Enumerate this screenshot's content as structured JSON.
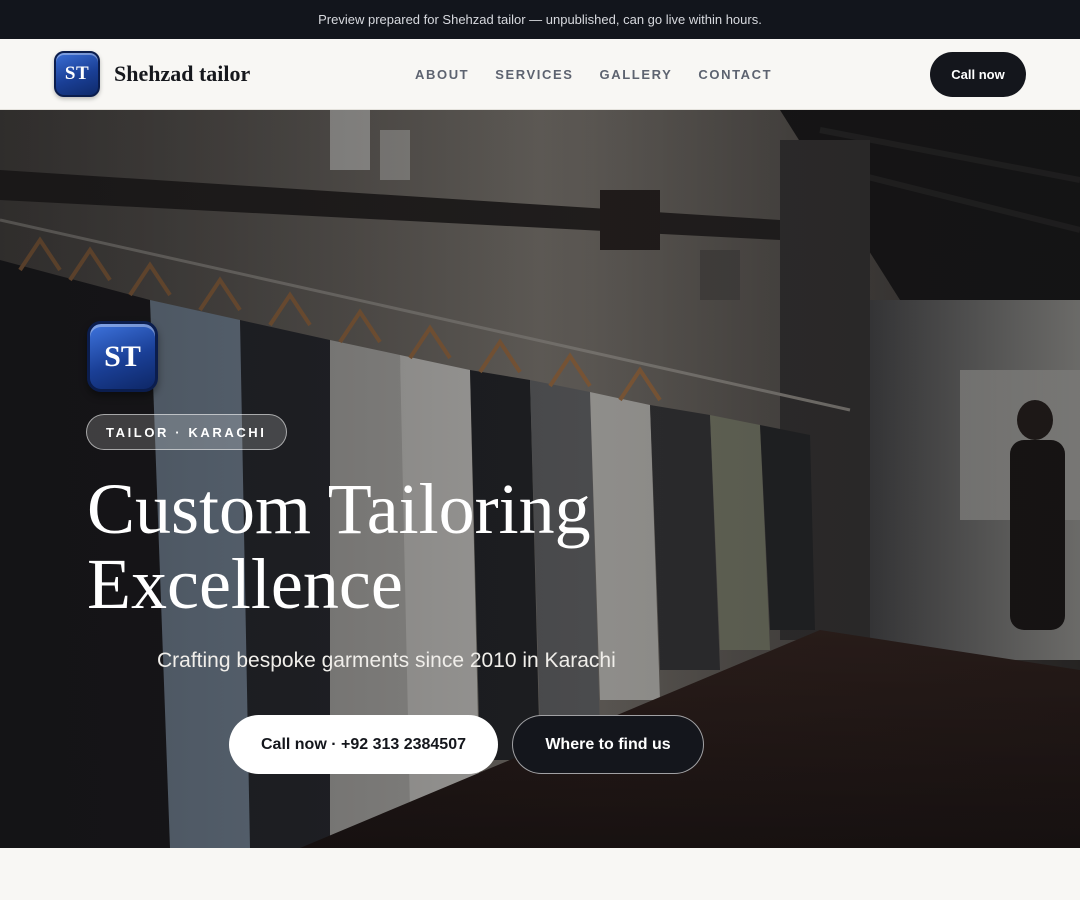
{
  "preview_bar": {
    "text": "Preview prepared for Shehzad tailor — unpublished, can go live within hours."
  },
  "header": {
    "logo_initials": "ST",
    "brand_name": "Shehzad tailor",
    "nav": [
      {
        "label": "ABOUT"
      },
      {
        "label": "SERVICES"
      },
      {
        "label": "GALLERY"
      },
      {
        "label": "CONTACT"
      }
    ],
    "cta_label": "Call now"
  },
  "hero": {
    "logo_initials": "ST",
    "pill_label": "TAILOR · KARACHI",
    "title_line_1": "Custom Tailoring",
    "title_line_2": "Excellence",
    "subtitle": "Crafting bespoke garments since 2010 in Karachi",
    "primary_button": "Call now · +92 313 2384507",
    "secondary_button": "Where to find us"
  },
  "colors": {
    "preview_bar_bg": "#12151c",
    "header_bg": "#f8f7f4",
    "cta_dark": "#14161c",
    "logo_blue": "#1a3f96",
    "nav_text": "#5d6370",
    "hero_text": "#ffffff"
  },
  "icons": {
    "brand_logo": "st-monogram-badge",
    "hero_logo": "st-monogram-badge"
  }
}
